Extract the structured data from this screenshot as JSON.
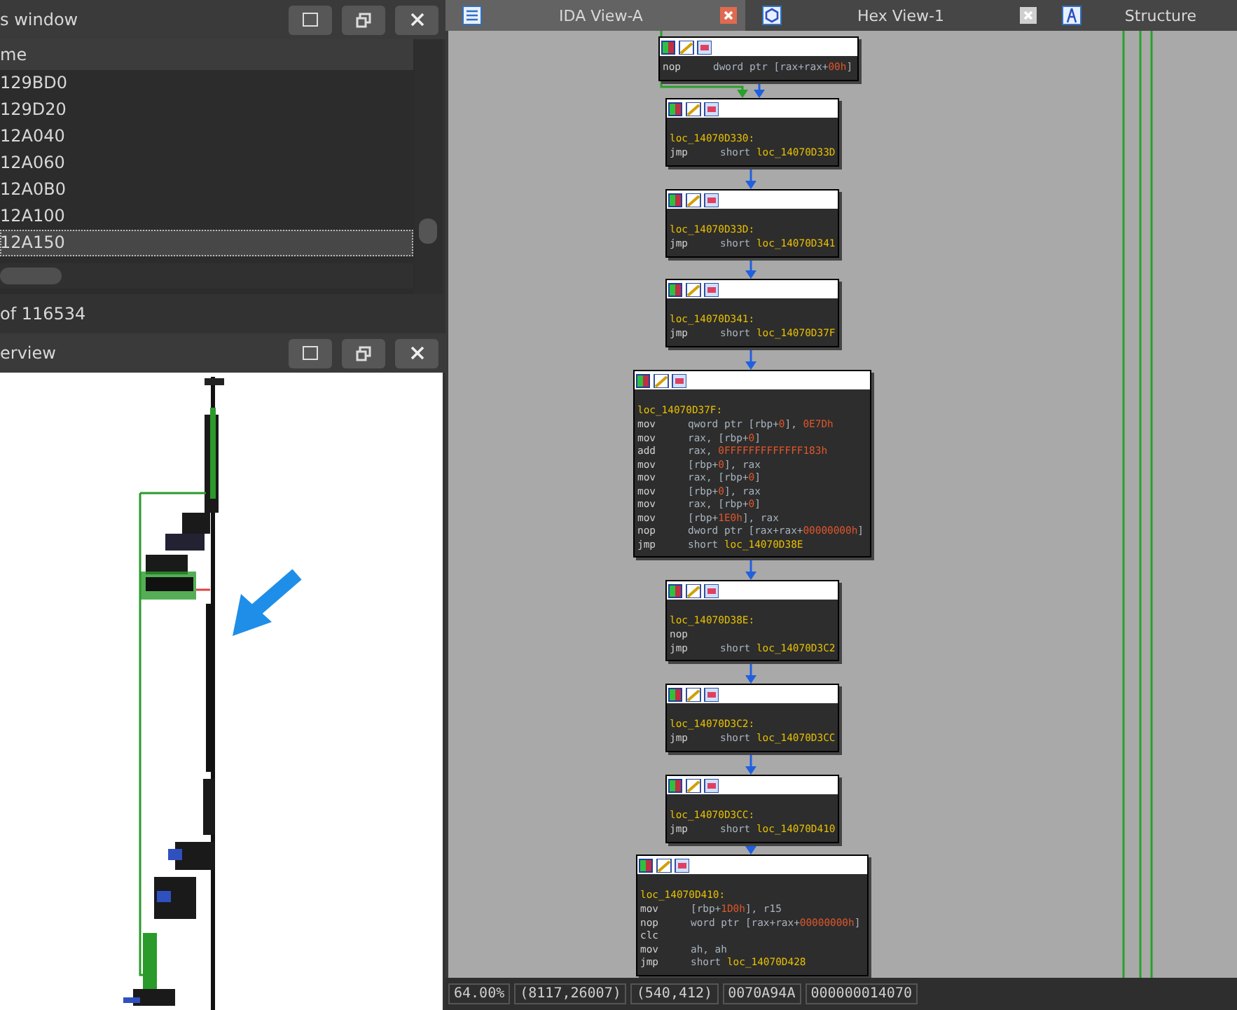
{
  "functions_window": {
    "title": "s window",
    "column_header": "me",
    "rows": [
      {
        "name": "129BD0",
        "selected": false
      },
      {
        "name": "129D20",
        "selected": false
      },
      {
        "name": "12A040",
        "selected": false
      },
      {
        "name": "12A060",
        "selected": false
      },
      {
        "name": "12A0B0",
        "selected": false
      },
      {
        "name": "12A100",
        "selected": false
      },
      {
        "name": "12A150",
        "selected": true
      }
    ],
    "status": "of 116534"
  },
  "graph_overview": {
    "title": "erview"
  },
  "tabs": [
    {
      "label": "IDA View-A",
      "selected": true,
      "kind": "disassembly"
    },
    {
      "label": "Hex View-1",
      "selected": false,
      "kind": "hex"
    },
    {
      "label": "Structure",
      "selected": false,
      "kind": "structures"
    }
  ],
  "blocks": [
    {
      "lines": [
        {
          "mnemonic": "nop",
          "operands": [
            {
              "text": "dword ptr [rax+rax+",
              "kind": "text"
            },
            {
              "text": "00h",
              "kind": "num"
            },
            {
              "text": "]",
              "kind": "text"
            }
          ]
        }
      ]
    },
    {
      "label": "loc_14070D330:",
      "lines": [
        {
          "mnemonic": "jmp",
          "operands": [
            {
              "text": "short ",
              "kind": "text"
            },
            {
              "text": "loc_14070D33D",
              "kind": "label"
            }
          ]
        }
      ]
    },
    {
      "label": "loc_14070D33D:",
      "lines": [
        {
          "mnemonic": "jmp",
          "operands": [
            {
              "text": "short ",
              "kind": "text"
            },
            {
              "text": "loc_14070D341",
              "kind": "label"
            }
          ]
        }
      ]
    },
    {
      "label": "loc_14070D341:",
      "lines": [
        {
          "mnemonic": "jmp",
          "operands": [
            {
              "text": "short ",
              "kind": "text"
            },
            {
              "text": "loc_14070D37F",
              "kind": "label"
            }
          ]
        }
      ]
    },
    {
      "label": "loc_14070D37F:",
      "lines": [
        {
          "mnemonic": "mov",
          "operands": [
            {
              "text": "qword ptr [rbp+",
              "kind": "text"
            },
            {
              "text": "0",
              "kind": "num"
            },
            {
              "text": "], ",
              "kind": "text"
            },
            {
              "text": "0E7Dh",
              "kind": "num"
            }
          ]
        },
        {
          "mnemonic": "mov",
          "operands": [
            {
              "text": "rax, [rbp+",
              "kind": "text"
            },
            {
              "text": "0",
              "kind": "num"
            },
            {
              "text": "]",
              "kind": "text"
            }
          ]
        },
        {
          "mnemonic": "add",
          "operands": [
            {
              "text": "rax, ",
              "kind": "text"
            },
            {
              "text": "0FFFFFFFFFFFFF183h",
              "kind": "num"
            }
          ]
        },
        {
          "mnemonic": "mov",
          "operands": [
            {
              "text": "[rbp+",
              "kind": "text"
            },
            {
              "text": "0",
              "kind": "num"
            },
            {
              "text": "], rax",
              "kind": "text"
            }
          ]
        },
        {
          "mnemonic": "mov",
          "operands": [
            {
              "text": "rax, [rbp+",
              "kind": "text"
            },
            {
              "text": "0",
              "kind": "num"
            },
            {
              "text": "]",
              "kind": "text"
            }
          ]
        },
        {
          "mnemonic": "mov",
          "operands": [
            {
              "text": "[rbp+",
              "kind": "text"
            },
            {
              "text": "0",
              "kind": "num"
            },
            {
              "text": "], rax",
              "kind": "text"
            }
          ]
        },
        {
          "mnemonic": "mov",
          "operands": [
            {
              "text": "rax, [rbp+",
              "kind": "text"
            },
            {
              "text": "0",
              "kind": "num"
            },
            {
              "text": "]",
              "kind": "text"
            }
          ]
        },
        {
          "mnemonic": "mov",
          "operands": [
            {
              "text": "[rbp+",
              "kind": "text"
            },
            {
              "text": "1E0h",
              "kind": "num"
            },
            {
              "text": "], rax",
              "kind": "text"
            }
          ]
        },
        {
          "mnemonic": "nop",
          "operands": [
            {
              "text": "dword ptr [rax+rax+",
              "kind": "text"
            },
            {
              "text": "00000000h",
              "kind": "num"
            },
            {
              "text": "]",
              "kind": "text"
            }
          ]
        },
        {
          "mnemonic": "jmp",
          "operands": [
            {
              "text": "short ",
              "kind": "text"
            },
            {
              "text": "loc_14070D38E",
              "kind": "label"
            }
          ]
        }
      ]
    },
    {
      "label": "loc_14070D38E:",
      "lines": [
        {
          "mnemonic": "nop"
        },
        {
          "mnemonic": "jmp",
          "operands": [
            {
              "text": "short ",
              "kind": "text"
            },
            {
              "text": "loc_14070D3C2",
              "kind": "label"
            }
          ]
        }
      ]
    },
    {
      "label": "loc_14070D3C2:",
      "lines": [
        {
          "mnemonic": "jmp",
          "operands": [
            {
              "text": "short ",
              "kind": "text"
            },
            {
              "text": "loc_14070D3CC",
              "kind": "label"
            }
          ]
        }
      ]
    },
    {
      "label": "loc_14070D3CC:",
      "lines": [
        {
          "mnemonic": "jmp",
          "operands": [
            {
              "text": "short ",
              "kind": "text"
            },
            {
              "text": "loc_14070D410",
              "kind": "label"
            }
          ]
        }
      ]
    },
    {
      "label": "loc_14070D410:",
      "lines": [
        {
          "mnemonic": "mov",
          "operands": [
            {
              "text": "[rbp+",
              "kind": "text"
            },
            {
              "text": "1D0h",
              "kind": "num"
            },
            {
              "text": "], r15",
              "kind": "text"
            }
          ]
        },
        {
          "mnemonic": "nop",
          "operands": [
            {
              "text": "word ptr [rax+rax+",
              "kind": "text"
            },
            {
              "text": "00000000h",
              "kind": "num"
            },
            {
              "text": "]",
              "kind": "text"
            }
          ]
        },
        {
          "mnemonic": "clc"
        },
        {
          "mnemonic": "mov",
          "operands": [
            {
              "text": "ah, ah",
              "kind": "text"
            }
          ]
        },
        {
          "mnemonic": "jmp",
          "operands": [
            {
              "text": "short ",
              "kind": "text"
            },
            {
              "text": "loc_14070D428",
              "kind": "label"
            }
          ]
        }
      ]
    }
  ],
  "status_bar": [
    "64.00%",
    "(8117,26007)",
    "(540,412)",
    "0070A94A",
    "000000014070"
  ]
}
